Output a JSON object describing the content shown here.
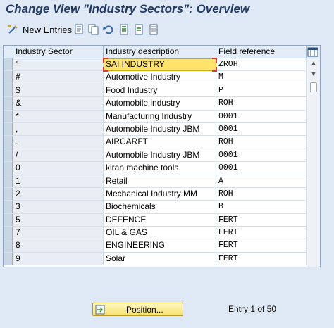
{
  "window": {
    "title": "Change View \"Industry Sectors\": Overview"
  },
  "toolbar": {
    "new_entries_label": "New Entries",
    "icons": [
      "change-display-icon",
      "copy-icon",
      "delete-icon",
      "undo-icon",
      "select-all-icon",
      "select-block-icon",
      "deselect-all-icon"
    ]
  },
  "table": {
    "columns": [
      "Industry Sector",
      "Industry description",
      "Field reference"
    ],
    "rows": [
      {
        "sector": "\"",
        "description": "SAI INDUSTRY",
        "field_reference": "ZROH"
      },
      {
        "sector": "#",
        "description": "Automotive Industry",
        "field_reference": "M"
      },
      {
        "sector": "$",
        "description": "Food Industry",
        "field_reference": "P"
      },
      {
        "sector": "&",
        "description": "Automobile industry",
        "field_reference": "ROH"
      },
      {
        "sector": "*",
        "description": "Manufacturing Industry",
        "field_reference": "0001"
      },
      {
        "sector": ",",
        "description": "Automobile Industry JBM",
        "field_reference": "0001"
      },
      {
        "sector": ".",
        "description": "AIRCARFT",
        "field_reference": "ROH"
      },
      {
        "sector": "/",
        "description": "Automobile Industry JBM",
        "field_reference": "0001"
      },
      {
        "sector": "0",
        "description": "kiran machine tools",
        "field_reference": "0001"
      },
      {
        "sector": "1",
        "description": "Retail",
        "field_reference": "A"
      },
      {
        "sector": "2",
        "description": "Mechanical Industry MM",
        "field_reference": "ROH"
      },
      {
        "sector": "3",
        "description": "Biochemicals",
        "field_reference": "B"
      },
      {
        "sector": "5",
        "description": "DEFENCE",
        "field_reference": "FERT"
      },
      {
        "sector": "7",
        "description": "OIL & GAS",
        "field_reference": "FERT"
      },
      {
        "sector": "8",
        "description": "ENGINEERING",
        "field_reference": "FERT"
      },
      {
        "sector": "9",
        "description": "Solar",
        "field_reference": "FERT"
      }
    ]
  },
  "footer": {
    "position_button_label": "Position...",
    "entry_info": "Entry 1 of 50"
  },
  "colors": {
    "title": "#1f3a66",
    "background": "#dfe9f5",
    "highlight": "#ffe36b"
  }
}
